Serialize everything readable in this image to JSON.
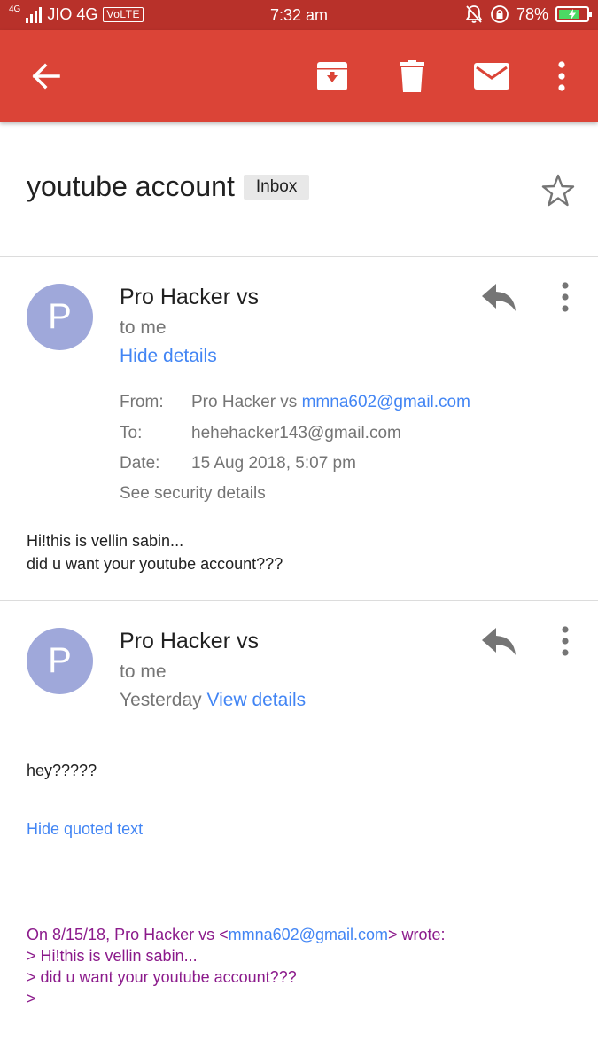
{
  "status_bar": {
    "network_badge": "4G",
    "carrier": "JIO 4G",
    "volte": "VoLTE",
    "time": "7:32 am",
    "battery_percent": "78%",
    "battery_level": 0.78
  },
  "toolbar": {
    "icons": [
      "back-arrow-icon",
      "archive-icon",
      "delete-icon",
      "mark-unread-icon",
      "more-vert-icon"
    ]
  },
  "thread": {
    "subject": "youtube account",
    "label": "Inbox",
    "starred": false
  },
  "messages": [
    {
      "avatar_letter": "P",
      "sender": "Pro Hacker vs",
      "to": "to me",
      "details_toggle": "Hide details",
      "details": {
        "from_label": "From:",
        "from_name": "Pro Hacker vs",
        "from_email": "mmna602@gmail.com",
        "to_label": "To:",
        "to_email": "hehehacker143@gmail.com",
        "date_label": "Date:",
        "date_value": "15 Aug 2018, 5:07 pm",
        "security_link": "See security details"
      },
      "body_lines": [
        "Hi!this is vellin sabin...",
        "did u want your youtube account???"
      ]
    },
    {
      "avatar_letter": "P",
      "sender": "Pro Hacker vs",
      "to": "to me",
      "date": "Yesterday",
      "details_toggle": "View details",
      "body": "hey?????",
      "quote_toggle": "Hide quoted text",
      "quoted": {
        "intro_prefix": "On 8/15/18, Pro Hacker vs <",
        "intro_email": "mmna602@gmail.com",
        "intro_suffix": "> wrote:",
        "lines": [
          "> Hi!this is vellin sabin...",
          "> did u want your youtube account???",
          ">"
        ]
      }
    }
  ],
  "colors": {
    "status_bar": "#b8312a",
    "app_bar": "#db4437",
    "link": "#4285f4",
    "avatar": "#9fa8da",
    "quoted_text": "#8b1a8b",
    "battery_fill": "#4cd964"
  }
}
